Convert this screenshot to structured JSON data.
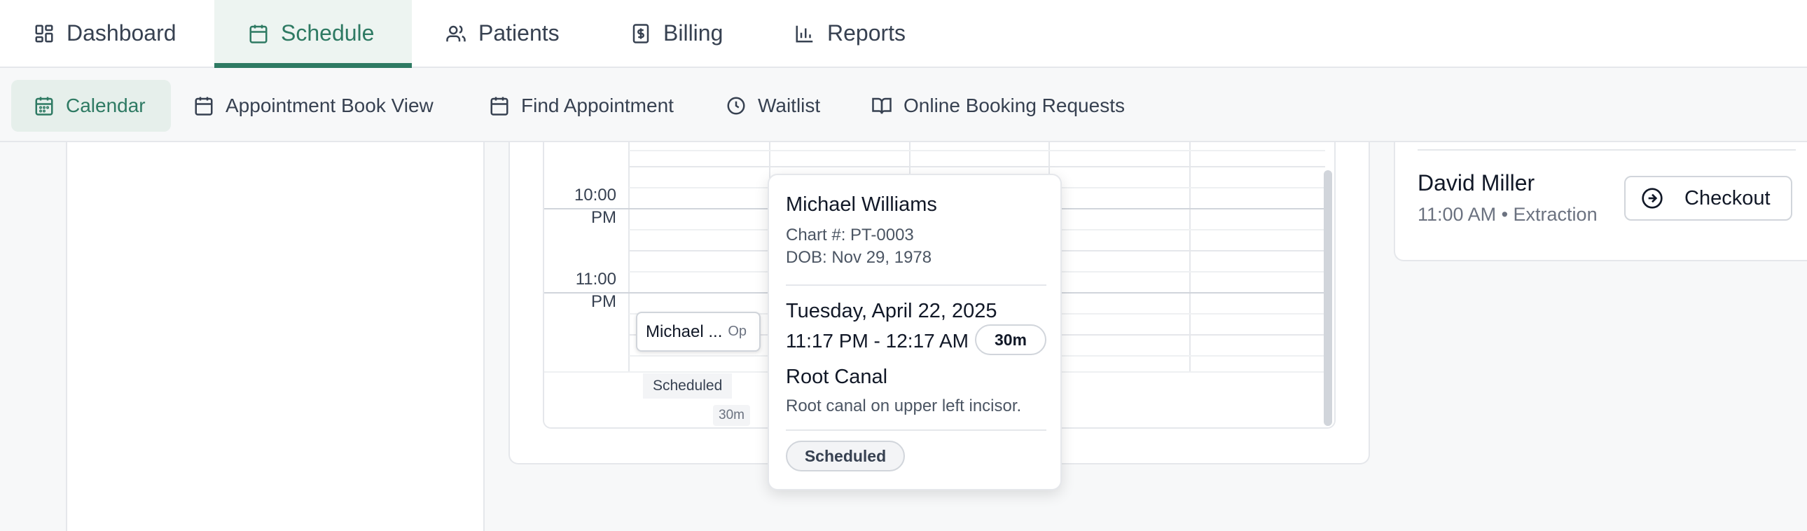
{
  "top_nav": {
    "tabs": [
      {
        "label": "Dashboard",
        "icon": "grid-icon"
      },
      {
        "label": "Schedule",
        "icon": "calendar-icon",
        "active": true
      },
      {
        "label": "Patients",
        "icon": "users-icon"
      },
      {
        "label": "Billing",
        "icon": "dollar-receipt-icon"
      },
      {
        "label": "Reports",
        "icon": "bar-chart-icon"
      }
    ]
  },
  "sub_nav": {
    "tabs": [
      {
        "label": "Calendar",
        "icon": "calendar-icon",
        "active": true
      },
      {
        "label": "Appointment Book View",
        "icon": "calendar-icon"
      },
      {
        "label": "Find Appointment",
        "icon": "calendar-icon"
      },
      {
        "label": "Waitlist",
        "icon": "clock-icon"
      },
      {
        "label": "Online Booking Requests",
        "icon": "book-open-icon"
      }
    ]
  },
  "calendar": {
    "time_slots": [
      {
        "line1": "10:00",
        "line2": "PM"
      },
      {
        "line1": "11:00",
        "line2": "PM"
      }
    ],
    "appointment_chip": {
      "name": "Michael ...",
      "op": "Op",
      "status": "Scheduled",
      "duration": "30m"
    }
  },
  "popover": {
    "patient_name": "Michael Williams",
    "chart": "Chart #: PT-0003",
    "dob": "DOB: Nov 29, 1978",
    "date": "Tuesday, April 22, 2025",
    "time_range": "11:17 PM - 12:17 AM",
    "duration": "30m",
    "procedure": "Root Canal",
    "note": "Root canal on upper left incisor.",
    "status": "Scheduled"
  },
  "checkout_panel": {
    "patient_name": "David Miller",
    "detail": "11:00 AM • Extraction",
    "button_label": "Checkout"
  },
  "colors": {
    "accent": "#2e7a63",
    "border": "#e5e7eb"
  }
}
